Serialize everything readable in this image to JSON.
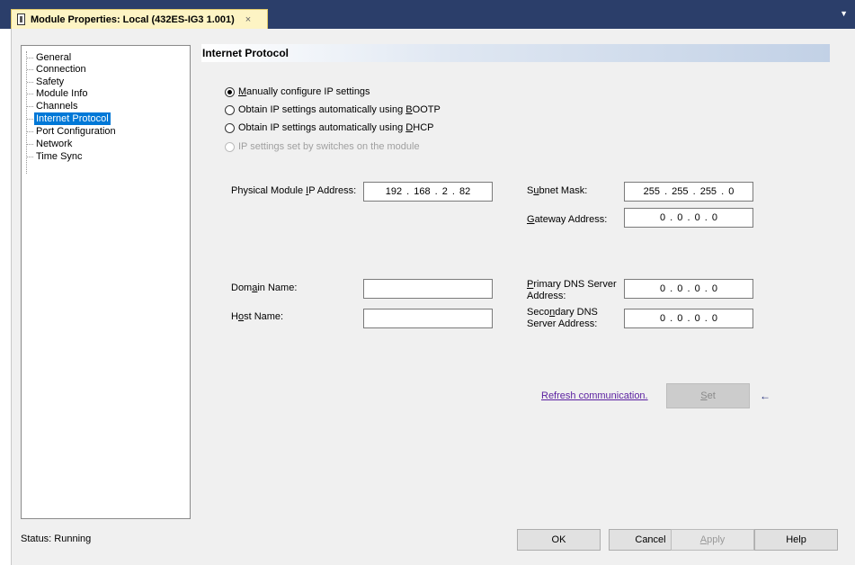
{
  "tab": {
    "title": "Module Properties: Local (432ES-IG3 1.001)",
    "close": "×"
  },
  "tree": {
    "items": [
      {
        "label": "General",
        "selected": false
      },
      {
        "label": "Connection",
        "selected": false
      },
      {
        "label": "Safety",
        "selected": false
      },
      {
        "label": "Module Info",
        "selected": false
      },
      {
        "label": "Channels",
        "selected": false
      },
      {
        "label": "Internet Protocol",
        "selected": true
      },
      {
        "label": "Port Configuration",
        "selected": false
      },
      {
        "label": "Network",
        "selected": false
      },
      {
        "label": "Time Sync",
        "selected": false
      }
    ]
  },
  "panel": {
    "title": "Internet Protocol"
  },
  "ip_options": {
    "manual": {
      "accel": "M",
      "rest": "anually configure IP settings",
      "checked": true
    },
    "bootp": {
      "pre": "Obtain IP settings automatically using ",
      "accel": "B",
      "rest": "OOTP",
      "checked": false
    },
    "dhcp": {
      "pre": "Obtain IP settings automatically using ",
      "accel": "D",
      "rest": "HCP",
      "checked": false
    },
    "switches": {
      "label": "IP settings set by switches on the module",
      "disabled": true
    }
  },
  "fields": {
    "physical_ip": {
      "pre": "Physical Module ",
      "accel": "I",
      "rest": "P Address:",
      "value": "192 . 168 .  2  .  82"
    },
    "subnet": {
      "pre": "S",
      "accel": "u",
      "rest": "bnet Mask:",
      "value": "255 . 255 . 255 .  0"
    },
    "gateway": {
      "accel": "G",
      "rest": "ateway Address:",
      "value": "0  .  0  .  0  .  0"
    },
    "domain": {
      "pre": "Dom",
      "accel": "a",
      "rest": "in Name:",
      "value": ""
    },
    "host": {
      "pre": "H",
      "accel": "o",
      "rest": "st Name:",
      "value": ""
    },
    "primary_dns": {
      "accel": "P",
      "rest": "rimary DNS Server",
      "line2": "Address:",
      "value": "0  .  0  .  0  .  0"
    },
    "secondary_dns": {
      "pre": "Seco",
      "accel": "n",
      "rest": "dary DNS",
      "line2": "Server Address:",
      "value": "0  .  0  .  0  .  0"
    }
  },
  "actions": {
    "refresh": "Refresh communication.",
    "set_pre": "",
    "set_accel": "S",
    "set_rest": "et",
    "arrow": "←"
  },
  "status": {
    "text": "Status:  Running"
  },
  "buttons": {
    "ok": "OK",
    "cancel": "Cancel",
    "apply_accel": "A",
    "apply_rest": "pply",
    "help": "Help"
  },
  "colors": {
    "titlebar": "#2b3e6a",
    "tab": "#fdf4c4",
    "selection": "#0078d7",
    "link": "#5a1fa0"
  }
}
